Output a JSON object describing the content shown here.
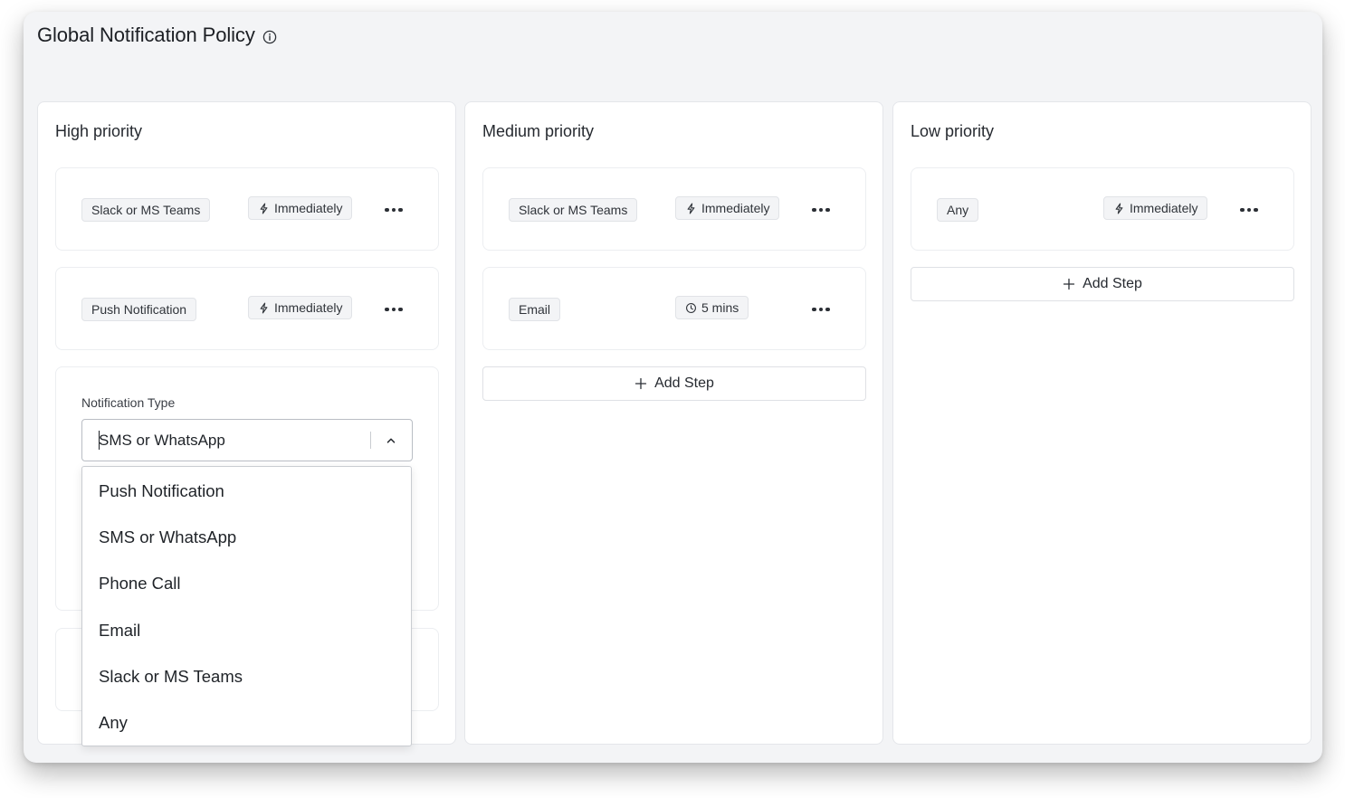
{
  "page": {
    "title": "Global Notification Policy",
    "title_icon": "info-icon"
  },
  "columns": [
    {
      "title": "High priority",
      "steps": [
        {
          "channel": "Slack or MS Teams",
          "timing": "Immediately",
          "timing_icon": "lightning-icon"
        },
        {
          "channel": "Push Notification",
          "timing": "Immediately",
          "timing_icon": "lightning-icon"
        }
      ],
      "editor": {
        "label": "Notification Type",
        "value": "SMS or WhatsApp",
        "options": [
          "Push Notification",
          "SMS or WhatsApp",
          "Phone Call",
          "Email",
          "Slack or MS Teams",
          "Any"
        ]
      }
    },
    {
      "title": "Medium priority",
      "steps": [
        {
          "channel": "Slack or MS Teams",
          "timing": "Immediately",
          "timing_icon": "lightning-icon"
        },
        {
          "channel": "Email",
          "timing": "5 mins",
          "timing_icon": "clock-icon"
        }
      ],
      "add_step_label": "Add Step"
    },
    {
      "title": "Low priority",
      "steps": [
        {
          "channel": "Any",
          "timing": "Immediately",
          "timing_icon": "lightning-icon"
        }
      ],
      "add_step_label": "Add Step"
    }
  ],
  "colors": {
    "background": "#f3f4f6",
    "card": "#ffffff",
    "border": "#e4e6ea",
    "tag_bg": "#f3f4f6",
    "text": "#1f2328"
  }
}
